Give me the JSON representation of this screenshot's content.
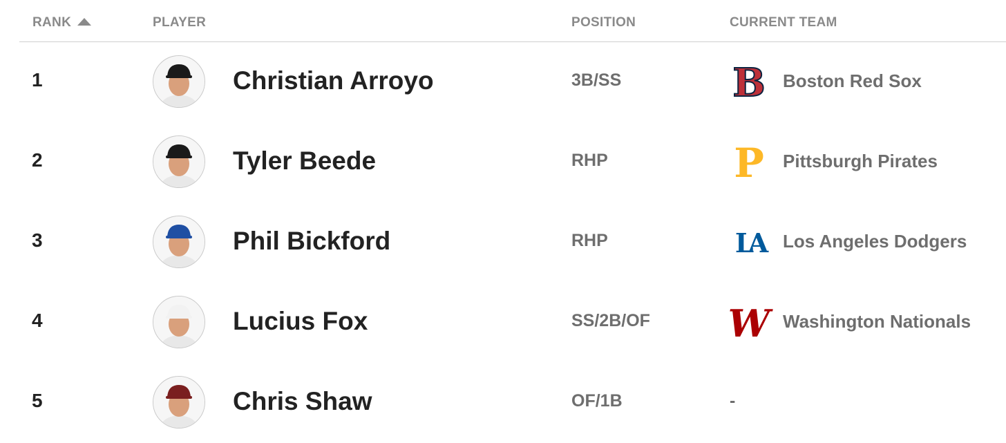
{
  "header": {
    "rank": "RANK",
    "player": "PLAYER",
    "position": "POSITION",
    "team": "CURRENT TEAM",
    "sort_icon": "sort-ascending-icon"
  },
  "rows": [
    {
      "rank": "1",
      "name": "Christian Arroyo",
      "position": "3B/SS",
      "team": "Boston Red Sox",
      "team_logo": "red-sox-logo",
      "logo_glyph": "B",
      "logo_color": "#bd3039",
      "cap_color": "#1a1a1a"
    },
    {
      "rank": "2",
      "name": "Tyler Beede",
      "position": "RHP",
      "team": "Pittsburgh Pirates",
      "team_logo": "pirates-logo",
      "logo_glyph": "P",
      "logo_color": "#fdb827",
      "cap_color": "#1a1a1a"
    },
    {
      "rank": "3",
      "name": "Phil Bickford",
      "position": "RHP",
      "team": "Los Angeles Dodgers",
      "team_logo": "dodgers-logo",
      "logo_glyph": "LA",
      "logo_color": "#005a9c",
      "cap_color": "#1f4fa3"
    },
    {
      "rank": "4",
      "name": "Lucius Fox",
      "position": "SS/2B/OF",
      "team": "Washington Nationals",
      "team_logo": "nationals-logo",
      "logo_glyph": "W",
      "logo_color": "#ab0003",
      "cap_color": "#f2f2f2"
    },
    {
      "rank": "5",
      "name": "Chris Shaw",
      "position": "OF/1B",
      "team": "-",
      "team_logo": "",
      "logo_glyph": "",
      "logo_color": "",
      "cap_color": "#7a1f1f"
    }
  ]
}
